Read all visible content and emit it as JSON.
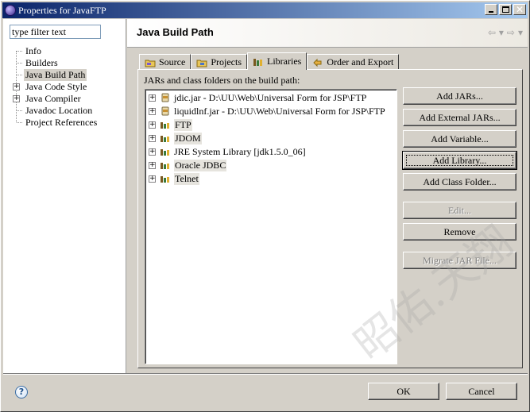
{
  "window": {
    "title": "Properties for JavaFTP"
  },
  "filter": {
    "value": "type filter text"
  },
  "nav_tree": [
    {
      "label": "Info",
      "expandable": false
    },
    {
      "label": "Builders",
      "expandable": false
    },
    {
      "label": "Java Build Path",
      "expandable": false,
      "selected": true
    },
    {
      "label": "Java Code Style",
      "expandable": true
    },
    {
      "label": "Java Compiler",
      "expandable": true
    },
    {
      "label": "Javadoc Location",
      "expandable": false
    },
    {
      "label": "Project References",
      "expandable": false
    }
  ],
  "page": {
    "title": "Java Build Path"
  },
  "tabs": [
    {
      "label": "Source",
      "icon": "source-folder-icon"
    },
    {
      "label": "Projects",
      "icon": "projects-icon"
    },
    {
      "label": "Libraries",
      "icon": "libraries-icon",
      "active": true
    },
    {
      "label": "Order and Export",
      "icon": "order-export-icon"
    }
  ],
  "libraries": {
    "heading": "JARs and class folders on the build path:",
    "items": [
      {
        "label": "jdic.jar - D:\\UU\\Web\\Universal Form for JSP\\FTP",
        "icon": "jar-icon"
      },
      {
        "label": "liquidlnf.jar - D:\\UU\\Web\\Universal Form for JSP\\FTP",
        "icon": "jar-icon"
      },
      {
        "label": "FTP",
        "icon": "library-icon",
        "shaded": true
      },
      {
        "label": "JDOM",
        "icon": "library-icon",
        "shaded": true
      },
      {
        "label": "JRE System Library [jdk1.5.0_06]",
        "icon": "library-icon"
      },
      {
        "label": "Oracle JDBC",
        "icon": "library-icon",
        "shaded": true
      },
      {
        "label": "Telnet",
        "icon": "library-icon",
        "shaded": true
      }
    ]
  },
  "buttons": {
    "add_jars": "Add JARs...",
    "add_external_jars": "Add External JARs...",
    "add_variable": "Add Variable...",
    "add_library": "Add Library...",
    "add_class_folder": "Add Class Folder...",
    "edit": "Edit...",
    "remove": "Remove",
    "migrate": "Migrate JAR File...",
    "ok": "OK",
    "cancel": "Cancel"
  },
  "watermark": "昭佑.天翔",
  "colors": {
    "titlebar_start": "#0a246a",
    "titlebar_end": "#a6caf0",
    "face": "#d4d0c8"
  }
}
